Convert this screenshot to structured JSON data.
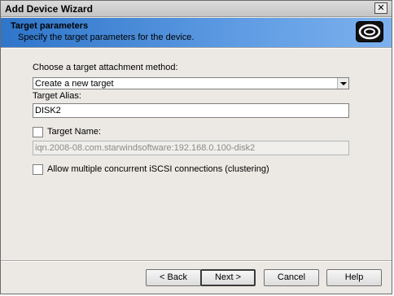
{
  "window": {
    "title": "Add Device Wizard",
    "close_glyph": "✕"
  },
  "header": {
    "title": "Target parameters",
    "subtitle": "Specify the target parameters for the device.",
    "icon": "starwind-logo-icon"
  },
  "form": {
    "attach_label": "Choose a target attachment method:",
    "attach_value": "Create a new target",
    "alias_label": "Target Alias:",
    "alias_value": "DISK2",
    "target_name_label": "Target Name:",
    "target_name_value": "iqn.2008-08.com.starwindsoftware:192.168.0.100-disk2",
    "target_name_checked": false,
    "multi_conn_label": "Allow multiple concurrent iSCSI connections (clustering)",
    "multi_conn_checked": false
  },
  "buttons": {
    "back": "< Back",
    "next": "Next >",
    "cancel": "Cancel",
    "help": "Help"
  }
}
